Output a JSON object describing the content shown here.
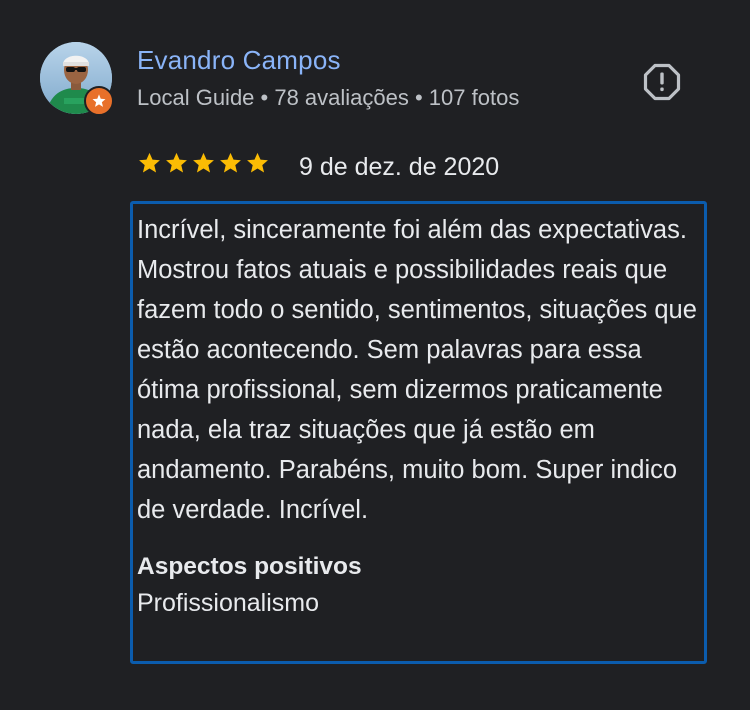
{
  "review": {
    "reviewer": {
      "name": "Evandro Campos",
      "meta": "Local Guide • 78 avaliações • 107 fotos",
      "avatar_icon": "user-avatar",
      "badge_icon": "local-guide-star-icon",
      "badge_color": "#e8702a"
    },
    "rating": {
      "stars": 5,
      "star_color": "#fbbc04"
    },
    "date": "9 de dez. de 2020",
    "text": "Incrível, sinceramente foi além das expectativas. Mostrou fatos atuais e possibilidades reais que fazem todo o sentido, sentimentos, situações que estão acontecendo. Sem palavras para essa ótima profissional, sem dizermos praticamente nada, ela traz situações que já estão em andamento. Parabéns, muito bom. Super indico de verdade. Incrível.",
    "aspects": {
      "title": "Aspectos positivos",
      "value": "Profissionalismo"
    },
    "report_icon": "report-icon",
    "focus_color": "#0b5cad"
  }
}
